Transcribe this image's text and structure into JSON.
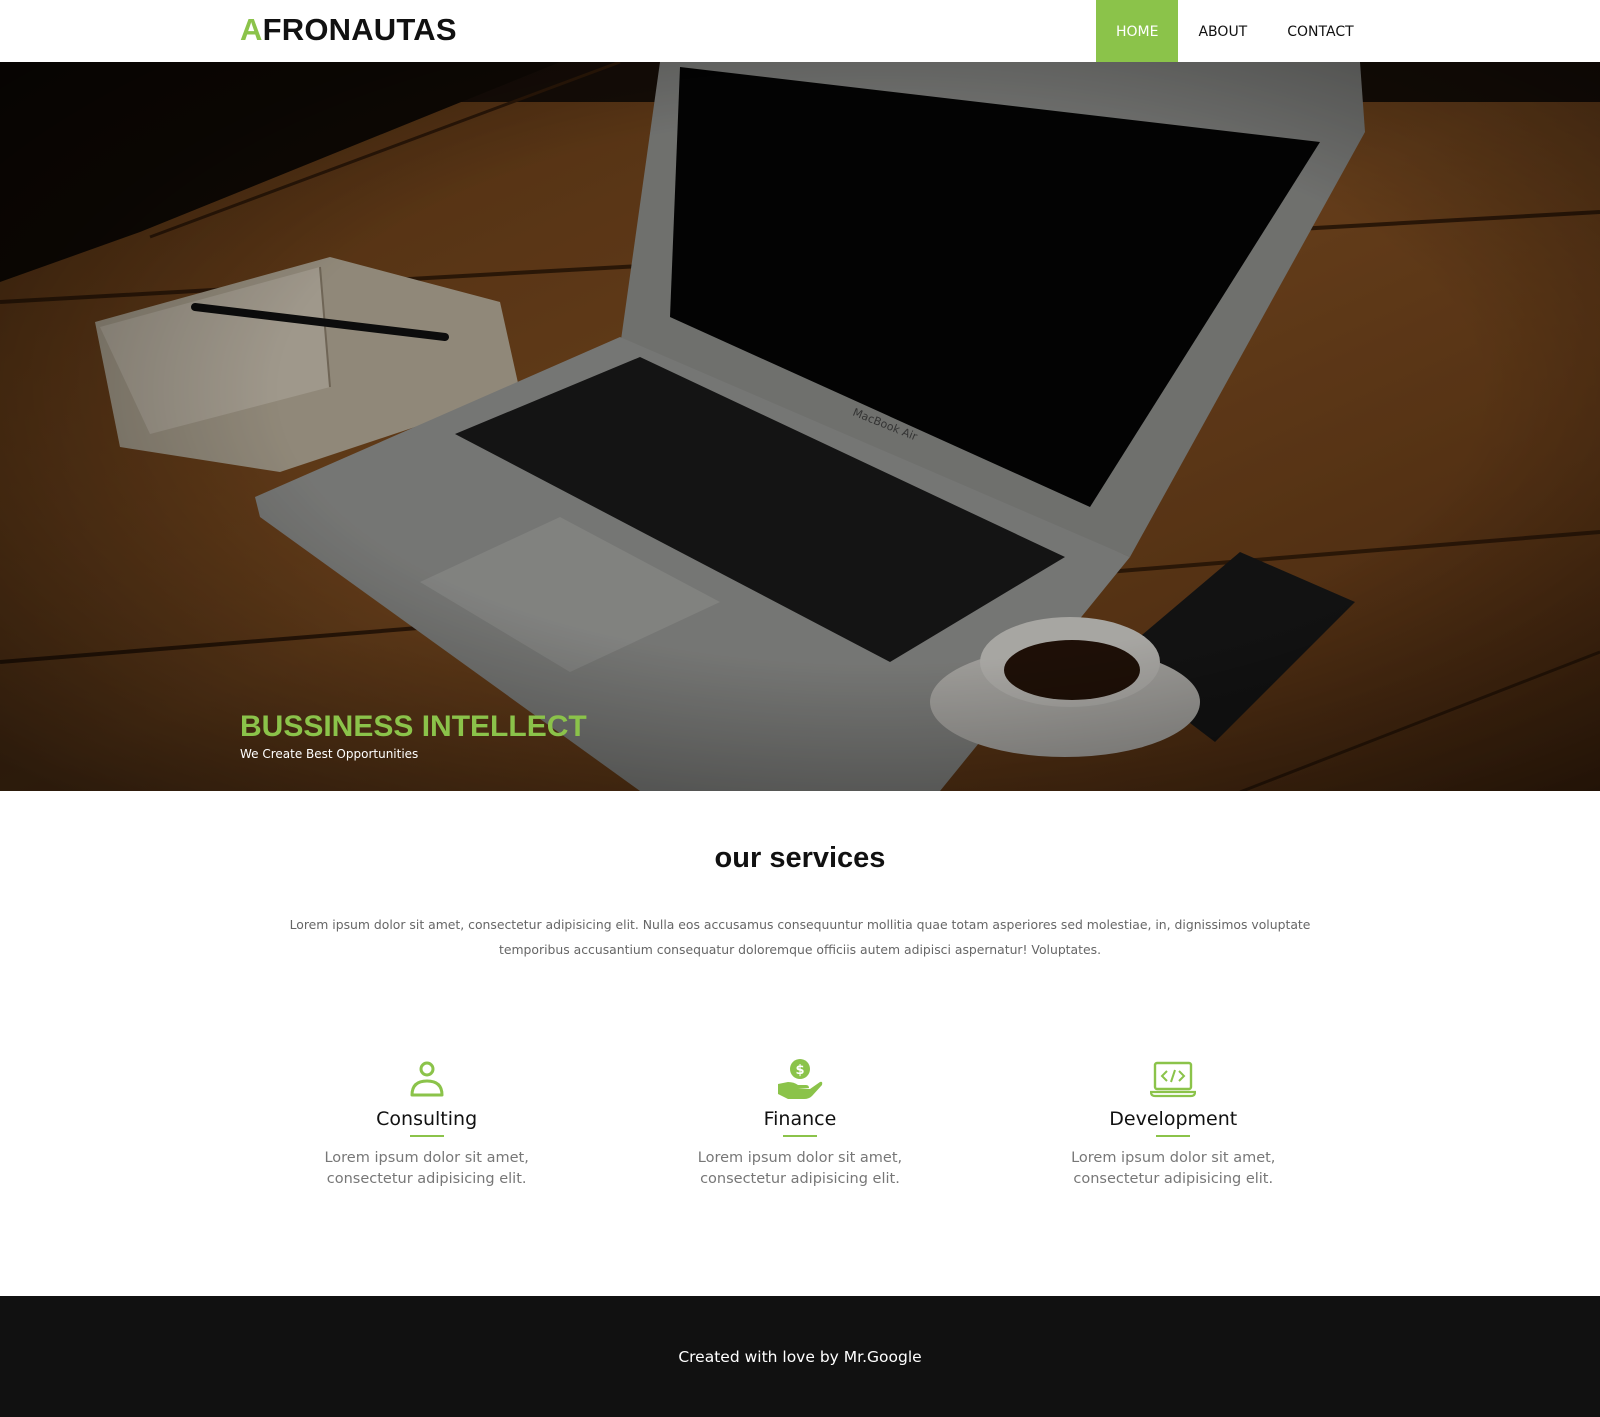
{
  "header": {
    "logo_first": "A",
    "logo_rest": "FRONAUTAS",
    "nav": [
      {
        "label": "HOME",
        "active": true
      },
      {
        "label": "ABOUT",
        "active": false
      },
      {
        "label": "CONTACT",
        "active": false
      }
    ]
  },
  "hero": {
    "title": "BUSSINESS INTELLECT",
    "subtitle": "We Create Best Opportunities",
    "laptop_brand": "MacBook Air"
  },
  "services": {
    "title": "our services",
    "description": "Lorem ipsum dolor sit amet, consectetur adipisicing elit. Nulla eos accusamus consequuntur mollitia quae totam asperiores sed molestiae, in, dignissimos voluptate temporibus accusantium consequatur doloremque officiis autem adipisci aspernatur! Voluptates.",
    "items": [
      {
        "name": "Consulting",
        "icon": "person-icon",
        "text": "Lorem ipsum dolor sit amet, consectetur adipisicing elit."
      },
      {
        "name": "Finance",
        "icon": "money-hand-icon",
        "text": "Lorem ipsum dolor sit amet, consectetur adipisicing elit."
      },
      {
        "name": "Development",
        "icon": "code-laptop-icon",
        "text": "Lorem ipsum dolor sit amet, consectetur adipisicing elit."
      }
    ]
  },
  "footer": {
    "text": "Created with love by Mr.Google"
  },
  "colors": {
    "accent": "#8bc34a",
    "footer_bg": "#111111",
    "text_dark": "#111111",
    "text_muted": "#777777"
  }
}
